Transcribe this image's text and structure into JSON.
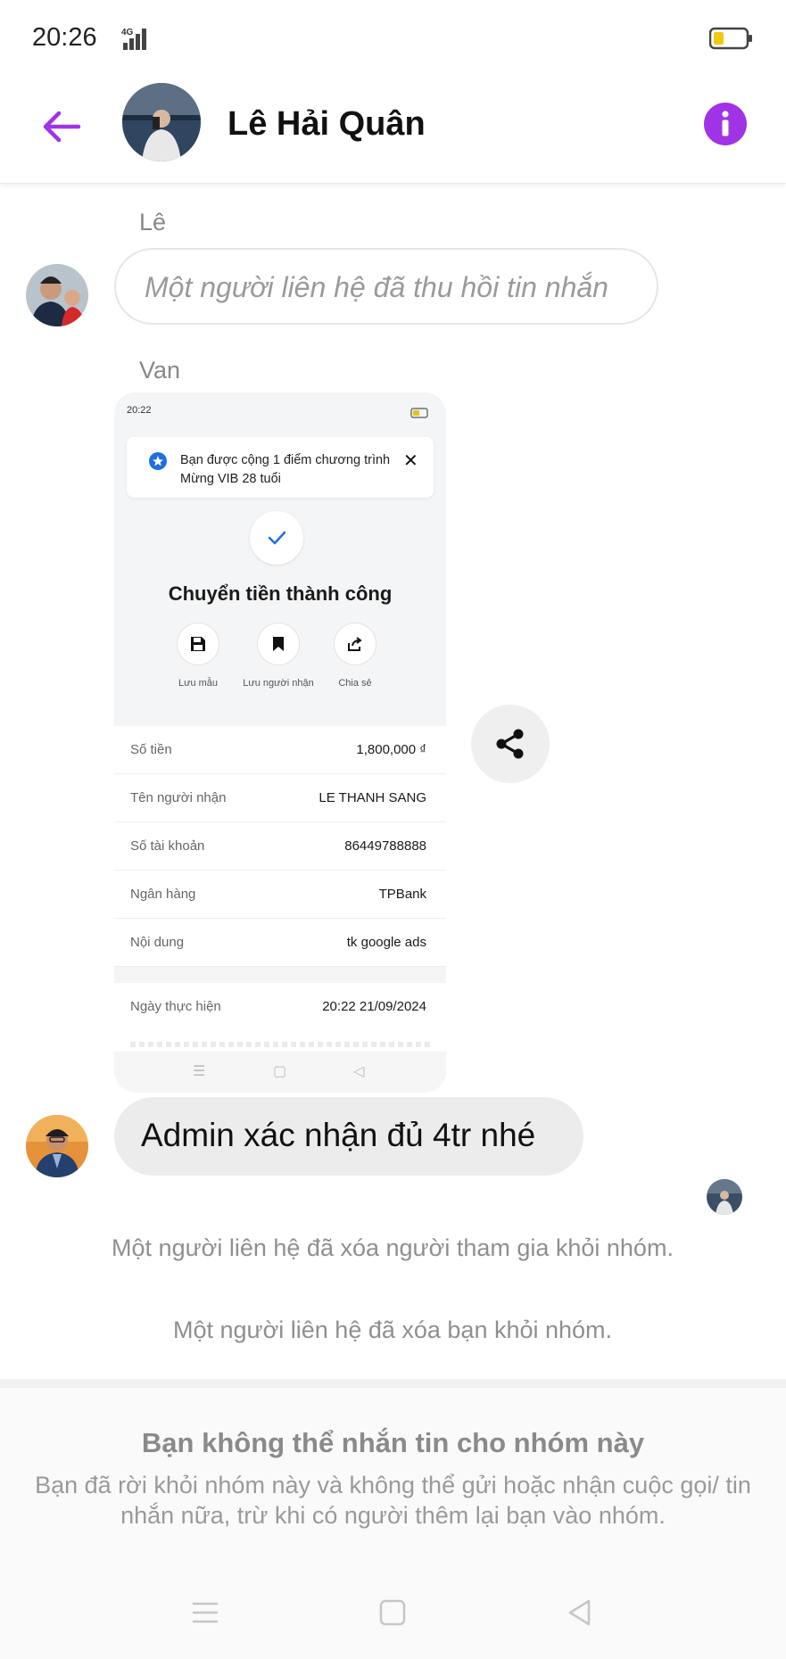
{
  "status_bar": {
    "time": "20:26",
    "network": "4G"
  },
  "header": {
    "title": "Lê Hải Quân",
    "accent_color": "#a033e6"
  },
  "messages": {
    "msg1": {
      "sender": "Lê",
      "text": "Một người liên hệ đã thu hồi tin nhắn"
    },
    "msg2": {
      "sender": "Van",
      "receipt": {
        "status_time": "20:22",
        "toast": "Bạn được cộng 1 điểm chương trình Mừng VIB 28 tuổi",
        "title": "Chuyển tiền thành công",
        "actions": [
          {
            "label": "Lưu mẫu"
          },
          {
            "label": "Lưu người nhận"
          },
          {
            "label": "Chia sẻ"
          }
        ],
        "rows": [
          {
            "key": "Số tiền",
            "value": "1,800,000 ₫"
          },
          {
            "key": "Tên người nhận",
            "value": "LE THANH SANG"
          },
          {
            "key": "Số tài khoản",
            "value": "86449788888"
          },
          {
            "key": "Ngân hàng",
            "value": "TPBank"
          },
          {
            "key": "Nội dung",
            "value": "tk google ads"
          }
        ],
        "date_key": "Ngày thực hiện",
        "date_value": "20:22 21/09/2024"
      }
    },
    "msg3": {
      "text": "Admin xác nhận đủ 4tr nhé"
    }
  },
  "system_messages": [
    "Một người liên hệ đã xóa người tham gia khỏi nhóm.",
    "Một người liên hệ đã xóa bạn khỏi nhóm."
  ],
  "footer": {
    "title": "Bạn không thể nhắn tin cho nhóm này",
    "description": "Bạn đã rời khỏi nhóm này và không thể gửi hoặc nhận cuộc gọi/ tin nhắn nữa, trừ khi có người thêm lại bạn vào nhóm."
  }
}
